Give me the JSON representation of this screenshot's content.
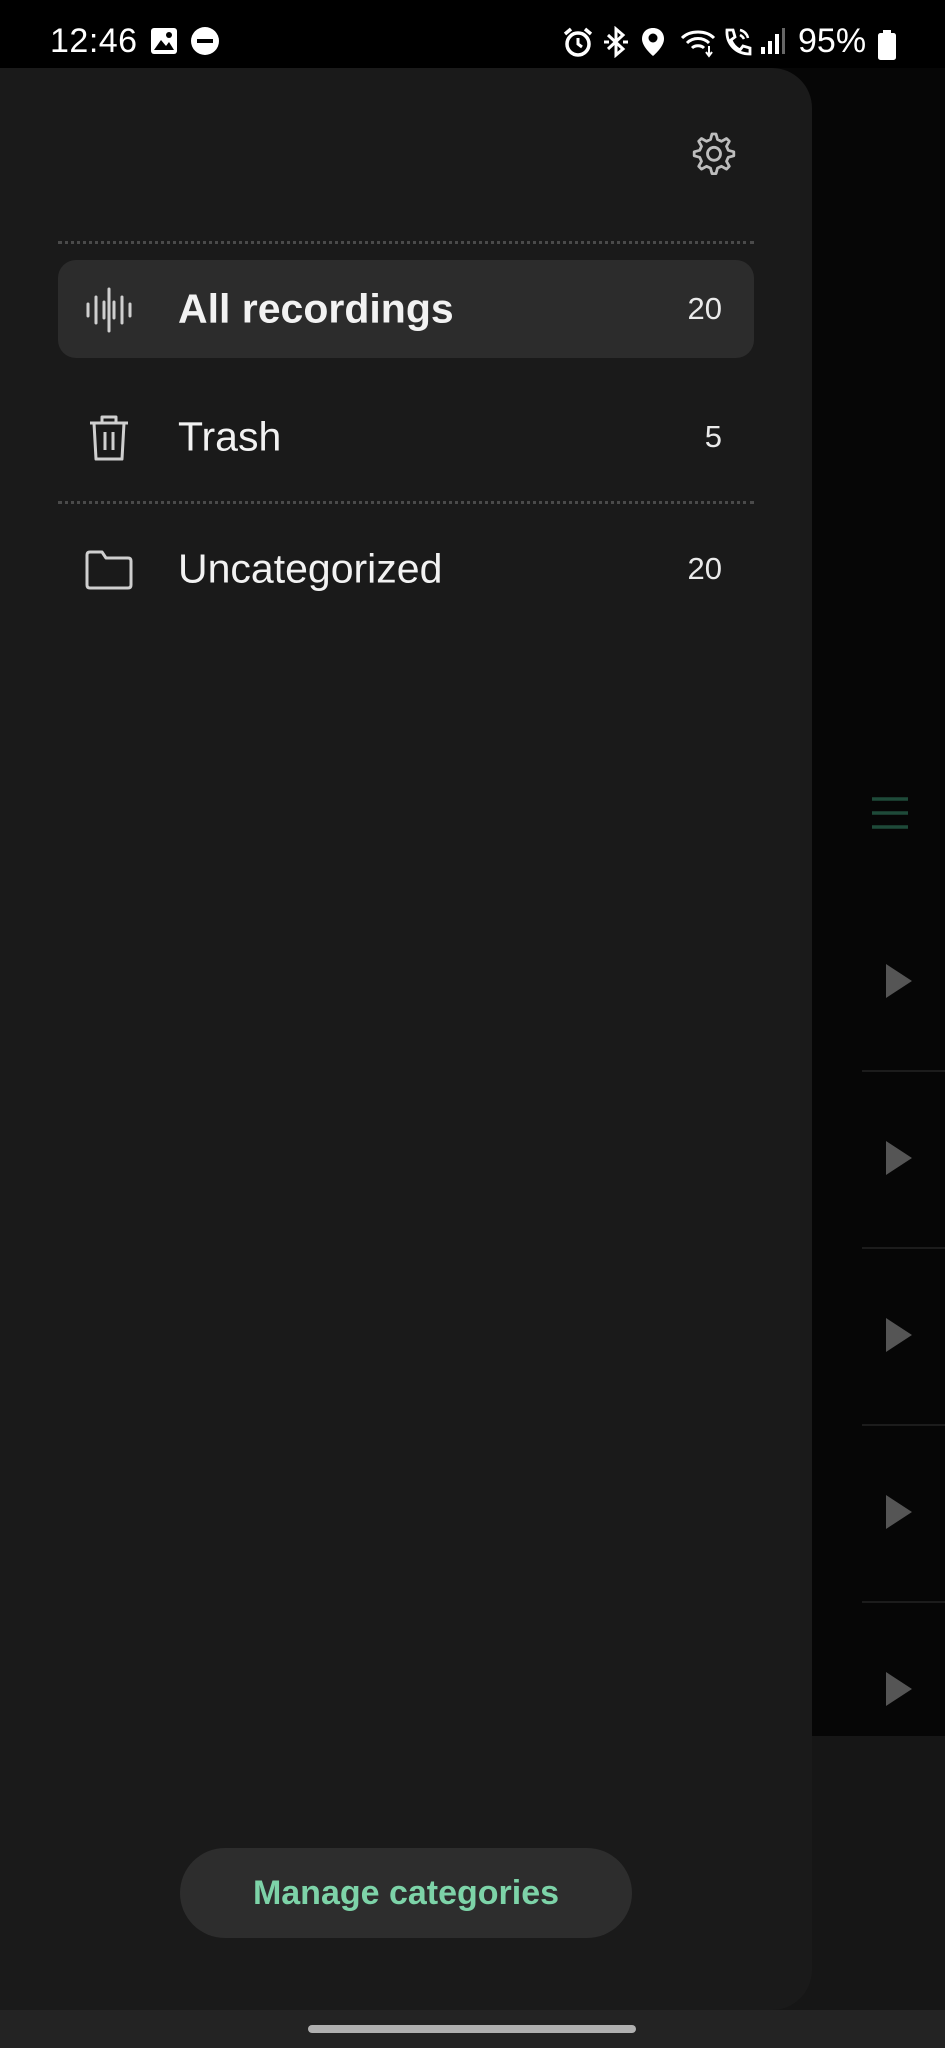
{
  "status_bar": {
    "time": "12:46",
    "battery": "95%",
    "left_icons": [
      "image-icon",
      "do-not-disturb-icon"
    ],
    "right_icons": [
      "alarm-icon",
      "bluetooth-icon",
      "location-icon",
      "wifi-icon",
      "wifi-call-icon",
      "signal-icon",
      "battery-icon"
    ]
  },
  "drawer": {
    "settings_icon": "gear-icon",
    "items": [
      {
        "label": "All recordings",
        "count": "20",
        "icon": "waveform-icon",
        "active": true
      },
      {
        "label": "Trash",
        "count": "5",
        "icon": "trash-icon",
        "active": false
      },
      {
        "label": "Uncategorized",
        "count": "20",
        "icon": "folder-icon",
        "active": false
      }
    ],
    "manage_button": "Manage categories"
  },
  "colors": {
    "drawer_bg": "#1a1a1a",
    "active_item_bg": "#2c2c2c",
    "accent": "#7dd3a8",
    "background": "#000000"
  }
}
